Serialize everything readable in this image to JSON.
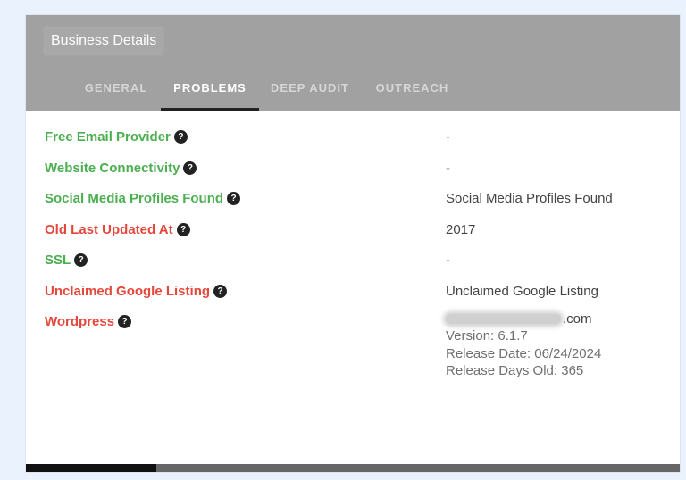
{
  "header": {
    "title": "Business Details",
    "tabs": [
      {
        "label": "GENERAL",
        "active": false
      },
      {
        "label": "PROBLEMS",
        "active": true
      },
      {
        "label": "DEEP AUDIT",
        "active": false
      },
      {
        "label": "OUTREACH",
        "active": false
      }
    ]
  },
  "icons": {
    "help": "?"
  },
  "colors": {
    "ok": "#4caf50",
    "bad": "#e5473b",
    "header_bg": "#a1a1a1"
  },
  "problems": [
    {
      "label": "Free Email Provider",
      "status": "ok",
      "value": "-"
    },
    {
      "label": "Website Connectivity",
      "status": "ok",
      "value": "-"
    },
    {
      "label": "Social Media Profiles Found",
      "status": "ok",
      "value": "Social Media Profiles Found"
    },
    {
      "label": "Old Last Updated At",
      "status": "bad",
      "value": "2017"
    },
    {
      "label": "SSL",
      "status": "ok",
      "value": "-"
    },
    {
      "label": "Unclaimed Google Listing",
      "status": "bad",
      "value": "Unclaimed Google Listing"
    },
    {
      "label": "Wordpress",
      "status": "bad"
    }
  ],
  "wordpress": {
    "domain_suffix": ".com",
    "version": "Version: 6.1.7",
    "release_date": "Release Date: 06/24/2024",
    "release_days_old": "Release Days Old: 365"
  },
  "footer": {
    "progress_fraction": 0.2
  }
}
